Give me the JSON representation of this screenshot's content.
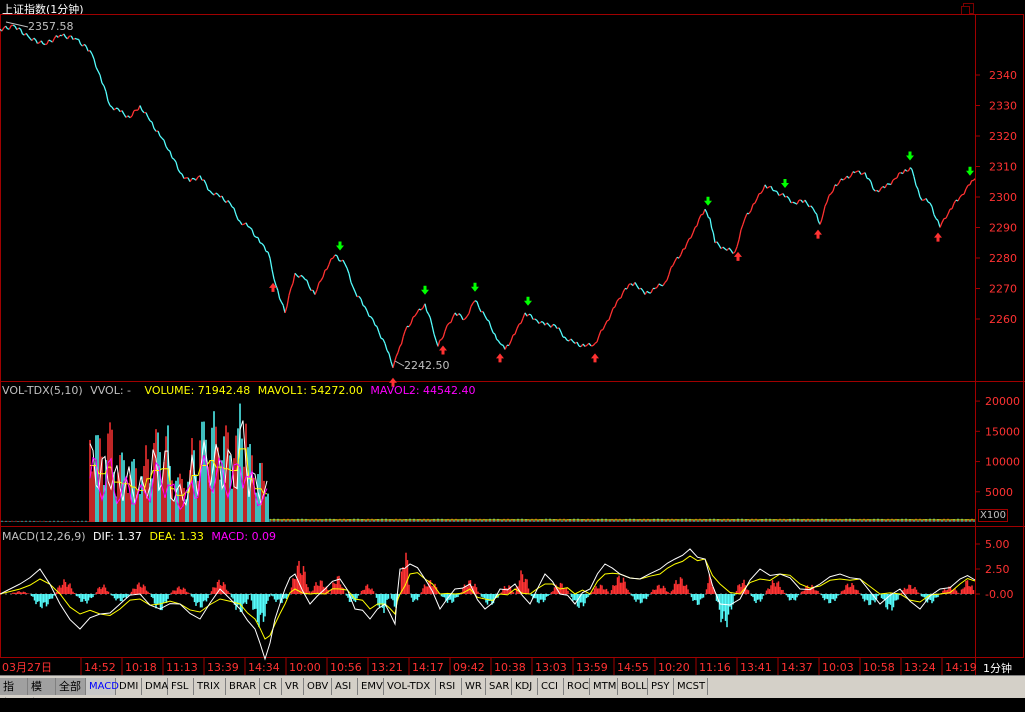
{
  "window": {
    "title": "上证指数(1分钟)"
  },
  "price_panel": {
    "high_label": "2357.58",
    "low_label": "2242.50"
  },
  "volume_header": {
    "name": "VOL-TDX(5,10)",
    "vvol": "VVOL: -",
    "volume": "VOLUME: 71942.48",
    "mavol1": "MAVOL1: 54272.00",
    "mavol2": "MAVOL2: 44542.40",
    "unit_label": "X100"
  },
  "macd_header": {
    "name": "MACD(12,26,9)",
    "dif": "DIF: 1.37",
    "dea": "DEA: 1.33",
    "macd": "MACD: 0.09"
  },
  "x_axis": {
    "labels": [
      "03月27日",
      "14:52",
      "10:18",
      "11:13",
      "13:39",
      "14:34",
      "10:00",
      "10:56",
      "13:21",
      "14:17",
      "09:42",
      "10:38",
      "13:03",
      "13:59",
      "14:55",
      "10:20",
      "11:16",
      "13:41",
      "14:37",
      "10:03",
      "10:58",
      "13:24",
      "14:19"
    ],
    "period": "1分钟"
  },
  "tabs": [
    "指标",
    "模板",
    "全部",
    "MACD",
    "DMI",
    "DMA",
    "FSL",
    "TRIX",
    "BRAR",
    "CR",
    "VR",
    "OBV",
    "ASI",
    "EMV",
    "VOL-TDX",
    "RSI",
    "WR",
    "SAR",
    "KDJ",
    "CCI",
    "ROC",
    "MTM",
    "BOLL",
    "PSY",
    "MCST"
  ],
  "active_tab": "MACD",
  "colors": {
    "up": "#ff3232",
    "down": "#54fcfc",
    "macd_dif": "#ffffff",
    "macd_dea": "#ffff00",
    "macd_label": "#ff00ff",
    "axis": "#a00000",
    "buy_arrow": "#ff3232",
    "sell_arrow": "#00ff00"
  },
  "chart_data": [
    {
      "type": "line",
      "name": "price",
      "ylim": [
        2240,
        2360
      ],
      "y_ticks": [
        2260,
        2270,
        2280,
        2290,
        2300,
        2310,
        2320,
        2330,
        2340
      ],
      "x": [
        0,
        15,
        30,
        45,
        60,
        75,
        90,
        100,
        110,
        120,
        130,
        140,
        150,
        160,
        170,
        180,
        190,
        200,
        210,
        220,
        230,
        240,
        250,
        260,
        268,
        276,
        285,
        295,
        305,
        315,
        325,
        335,
        345,
        355,
        365,
        375,
        385,
        393,
        398,
        405,
        415,
        425,
        432,
        438,
        445,
        455,
        465,
        475,
        485,
        495,
        500,
        505,
        515,
        525,
        535,
        545,
        555,
        565,
        575,
        585,
        595,
        605,
        615,
        625,
        635,
        645,
        655,
        665,
        675,
        685,
        695,
        705,
        710,
        715,
        725,
        735,
        745,
        755,
        765,
        775,
        785,
        795,
        805,
        815,
        820,
        825,
        835,
        845,
        855,
        865,
        875,
        885,
        895,
        905,
        912,
        920,
        930,
        940,
        950,
        960,
        970,
        975
      ],
      "values": [
        2355,
        2356,
        2352,
        2350,
        2353,
        2352,
        2348,
        2340,
        2330,
        2328,
        2326,
        2330,
        2325,
        2320,
        2315,
        2308,
        2305,
        2307,
        2302,
        2300,
        2298,
        2292,
        2290,
        2285,
        2282,
        2271,
        2262,
        2275,
        2273,
        2268,
        2276,
        2281,
        2278,
        2269,
        2264,
        2258,
        2252,
        2244,
        2249,
        2256,
        2261,
        2265,
        2258,
        2251,
        2256,
        2262,
        2260,
        2266,
        2261,
        2255,
        2252,
        2250,
        2255,
        2262,
        2260,
        2258,
        2258,
        2254,
        2252,
        2251,
        2252,
        2258,
        2264,
        2270,
        2272,
        2268,
        2270,
        2272,
        2279,
        2283,
        2290,
        2296,
        2293,
        2285,
        2283,
        2282,
        2293,
        2298,
        2304,
        2302,
        2300,
        2298,
        2299,
        2295,
        2291,
        2297,
        2304,
        2306,
        2308,
        2308,
        2302,
        2303,
        2306,
        2309,
        2309,
        2300,
        2298,
        2290,
        2296,
        2300,
        2304,
        2306
      ],
      "annotations": [
        {
          "label": "2357.58"
        },
        {
          "label": "2242.50"
        }
      ],
      "buy_arrows_x": [
        273,
        393,
        443,
        500,
        595,
        738,
        818,
        938
      ],
      "sell_arrows_x": [
        340,
        425,
        475,
        528,
        708,
        785,
        910,
        970
      ]
    },
    {
      "type": "bar",
      "name": "volume",
      "ylim": [
        0,
        22000
      ],
      "y_ticks": [
        5000,
        10000,
        15000,
        20000
      ],
      "unit": "X100",
      "segments": [
        {
          "x_range": [
            0,
            90
          ],
          "level": 150
        },
        {
          "x_range": [
            90,
            270
          ],
          "peak_values": [
            17000,
            14500,
            16500,
            12000,
            11500,
            10500,
            9500,
            13000,
            15500,
            16000,
            10000,
            8000,
            9000,
            14000,
            17000,
            18500,
            16500,
            16000,
            15500,
            22000,
            13000,
            10000,
            8500
          ]
        },
        {
          "x_range": [
            270,
            975
          ],
          "level": 400
        }
      ]
    },
    {
      "type": "bar",
      "name": "MACD",
      "ylim": [
        -6.5,
        6.5
      ],
      "y_ticks": [
        -0.0,
        2.5,
        5.0
      ],
      "x": [
        10,
        30,
        55,
        75,
        95,
        110,
        130,
        150,
        170,
        190,
        210,
        230,
        250,
        270,
        290,
        310,
        330,
        345,
        360,
        375,
        390,
        400,
        410,
        420,
        440,
        460,
        480,
        500,
        515,
        530,
        550,
        570,
        590,
        610,
        630,
        650,
        670,
        690,
        705,
        715,
        735,
        750,
        765,
        785,
        800,
        820,
        840,
        860,
        880,
        900,
        920,
        940,
        960
      ],
      "values": [
        0.3,
        -1.5,
        1.5,
        -1.0,
        1.0,
        -0.8,
        1.2,
        -1.8,
        0.8,
        -1.5,
        1.5,
        -2.0,
        -3.5,
        -1.0,
        3.5,
        1.5,
        2.0,
        -1.0,
        1.0,
        -2.0,
        -1.5,
        5.0,
        -1.0,
        1.5,
        -1.0,
        1.5,
        -1.2,
        1.0,
        2.5,
        -1.0,
        1.2,
        -1.5,
        1.0,
        2.0,
        -1.0,
        1.0,
        1.8,
        -1.2,
        2.0,
        -3.5,
        1.5,
        -1.0,
        1.5,
        -0.8,
        1.0,
        -1.0,
        1.2,
        -1.2,
        -1.8,
        1.0,
        -1.0,
        0.8,
        1.5
      ],
      "dif_x": [
        0,
        20,
        40,
        60,
        80,
        100,
        120,
        140,
        160,
        180,
        200,
        220,
        240,
        255,
        265,
        275,
        285,
        295,
        310,
        325,
        340,
        355,
        370,
        385,
        395,
        400,
        410,
        425,
        440,
        455,
        470,
        485,
        500,
        515,
        530,
        545,
        560,
        575,
        590,
        605,
        620,
        640,
        660,
        675,
        690,
        705,
        720,
        740,
        760,
        780,
        800,
        820,
        840,
        860,
        880,
        900,
        920,
        940,
        960,
        975
      ],
      "dif": [
        0,
        1,
        2.5,
        -1,
        -3.5,
        -2,
        -1,
        0,
        -1.5,
        -1,
        -2.5,
        0.5,
        -1.5,
        -3.5,
        -6.5,
        -2.5,
        0.5,
        2,
        -1,
        0.5,
        1.5,
        -1.5,
        -2.5,
        -1,
        -3,
        2.5,
        3,
        1.5,
        -1.5,
        0.5,
        1,
        -1.5,
        0.5,
        1,
        -1,
        2,
        0,
        -1,
        0.5,
        3,
        2,
        1.5,
        2.5,
        3.5,
        4.5,
        3.5,
        -1,
        -0.5,
        2.5,
        2,
        0.5,
        1,
        2,
        1.5,
        -1,
        0.5,
        -1.5,
        0.5,
        1.5,
        1.4
      ],
      "dea": [
        0,
        0.5,
        1.5,
        0,
        -2,
        -2,
        -1.5,
        -0.5,
        -1,
        -1,
        -1.8,
        -0.5,
        -1,
        -2.5,
        -4.5,
        -3,
        -1,
        0.5,
        0,
        0,
        0.5,
        -0.5,
        -1.5,
        -1,
        -2,
        0,
        2,
        1.5,
        0,
        0,
        0.5,
        -0.5,
        0,
        0.5,
        0,
        1,
        0.5,
        0,
        0,
        2,
        2,
        1.5,
        2,
        3,
        3.8,
        3.5,
        1,
        0,
        1.5,
        2,
        1,
        0.8,
        1.5,
        1.5,
        0,
        0,
        -0.8,
        0,
        1,
        1.3
      ]
    }
  ]
}
